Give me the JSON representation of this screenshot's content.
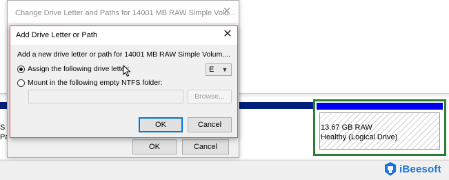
{
  "parent_dialog": {
    "title": "Change Drive Letter and Paths for 14001 MB RAW Simple Volu...",
    "ok_label": "OK",
    "cancel_label": "Cancel"
  },
  "dialog": {
    "title": "Add Drive Letter or Path",
    "description": "Add a new drive letter or path for 14001 MB RAW Simple Volum....",
    "option_assign_label": "Assign the following drive letter:",
    "option_mount_label": "Mount in the following empty NTFS folder:",
    "drive_letter_value": "E",
    "folder_path_value": "",
    "browse_label": "Browse...",
    "ok_label": "OK",
    "cancel_label": "Cancel",
    "selected_option": "assign"
  },
  "disk_management": {
    "left_partition_label_line1": "S",
    "left_partition_label_line2": "Pa",
    "volume_size": "13.67 GB RAW",
    "volume_status": "Healthy (Logical Drive)"
  },
  "watermark": {
    "brand": "iBeesoft"
  },
  "colors": {
    "primary_partition_bar": "#001e7c",
    "logical_partition_bar": "#0000ee",
    "selected_partition_border": "#2e7d32",
    "default_button_border": "#0078d7",
    "brand": "#1a73d9"
  },
  "icons": {
    "close": "close-icon",
    "dropdown": "chevron-down-icon",
    "pointer": "mouse-pointer-icon",
    "logo": "ibeesoft-logo-icon"
  }
}
